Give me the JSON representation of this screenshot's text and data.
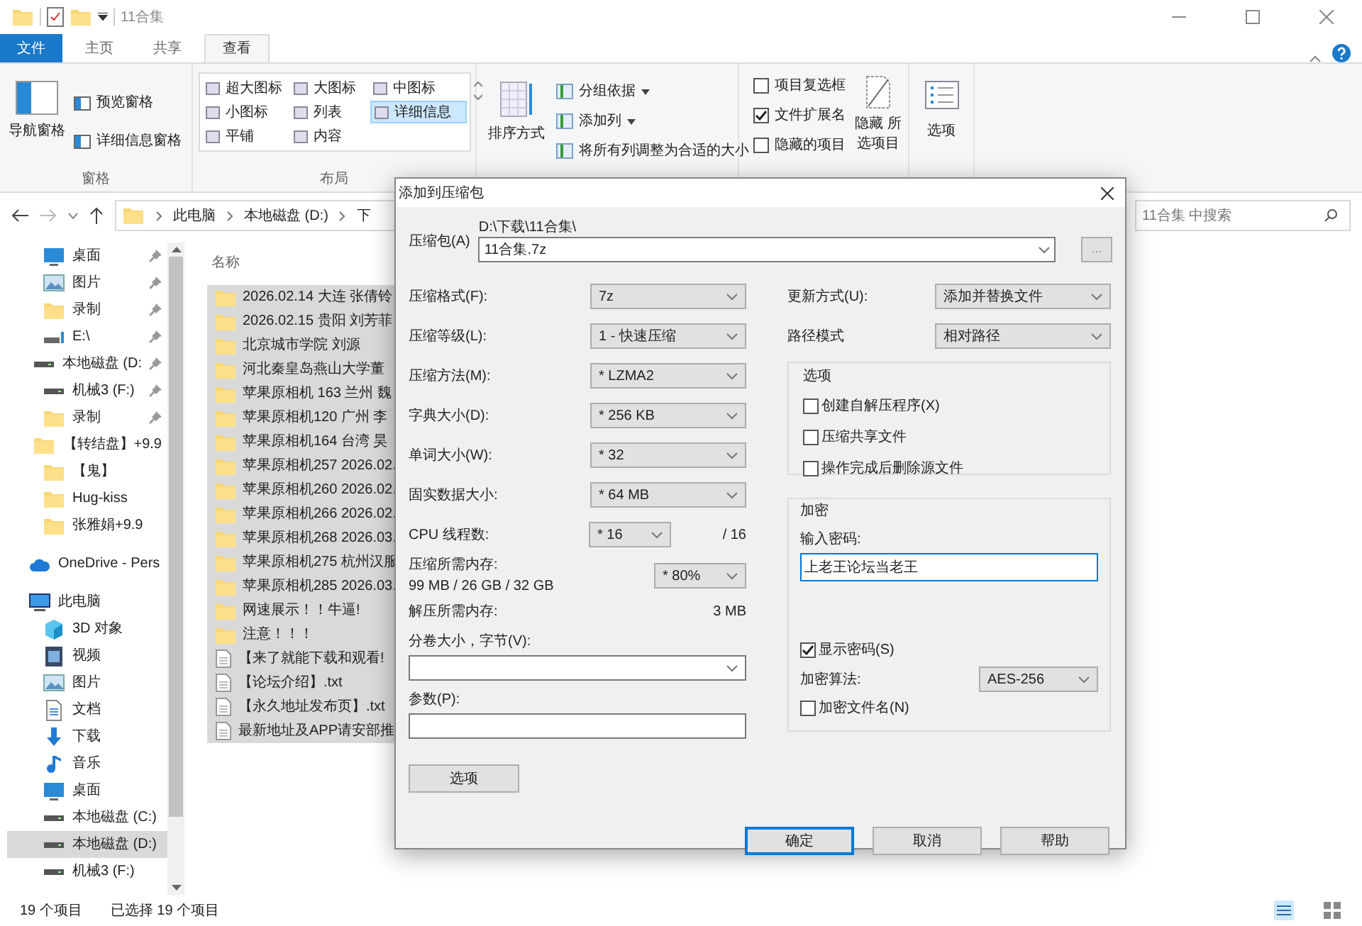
{
  "window": {
    "title": "11合集"
  },
  "ribbon_tabs": [
    {
      "label": "文件",
      "kind": "file",
      "selected": false
    },
    {
      "label": "主页",
      "kind": "tab",
      "selected": false
    },
    {
      "label": "共享",
      "kind": "tab",
      "selected": false
    },
    {
      "label": "查看",
      "kind": "tab",
      "selected": true
    }
  ],
  "ribbon": {
    "panes": {
      "nav_pane": "导航窗格",
      "buttons": [
        "预览窗格",
        "详细信息窗格"
      ],
      "group": "窗格"
    },
    "layout": {
      "options": [
        {
          "label": "超大图标",
          "selected": false
        },
        {
          "label": "大图标",
          "selected": false
        },
        {
          "label": "中图标",
          "selected": false
        },
        {
          "label": "小图标",
          "selected": false
        },
        {
          "label": "列表",
          "selected": false
        },
        {
          "label": "详细信息",
          "selected": true
        },
        {
          "label": "平铺",
          "selected": false
        },
        {
          "label": "内容",
          "selected": false
        }
      ],
      "group": "布局"
    },
    "current_view": {
      "sort": "排序方式",
      "buttons": [
        "分组依据",
        "添加列",
        "将所有列调整为合适的大小"
      ]
    },
    "show_hide": {
      "checkboxes": [
        {
          "label": "项目复选框",
          "checked": false
        },
        {
          "label": "文件扩展名",
          "checked": true
        },
        {
          "label": "隐藏的项目",
          "checked": false
        }
      ],
      "hide_selected": "隐藏 所选项目"
    },
    "options": "选项"
  },
  "address": {
    "crumbs": [
      "此电脑",
      "本地磁盘 (D:)",
      "下"
    ]
  },
  "search": {
    "placeholder": "11合集 中搜索"
  },
  "nav_pane": {
    "items": [
      {
        "label": "桌面",
        "kind": "desktop",
        "pinned": true,
        "selected": false
      },
      {
        "label": "图片",
        "kind": "pictures",
        "pinned": true,
        "selected": false
      },
      {
        "label": "录制",
        "kind": "folder",
        "pinned": true,
        "selected": false
      },
      {
        "label": "E:\\",
        "kind": "netdrive",
        "pinned": true,
        "selected": false
      },
      {
        "label": "本地磁盘 (D:",
        "kind": "drive",
        "pinned": true,
        "selected": false
      },
      {
        "label": "机械3 (F:)",
        "kind": "drive",
        "pinned": true,
        "selected": false
      },
      {
        "label": "录制",
        "kind": "folder",
        "pinned": true,
        "selected": false
      },
      {
        "label": "【转结盘】+9.9",
        "kind": "folder",
        "pinned": false,
        "selected": false
      },
      {
        "label": "【鬼】",
        "kind": "folder",
        "pinned": false,
        "selected": false
      },
      {
        "label": "Hug-kiss",
        "kind": "folder",
        "pinned": false,
        "selected": false
      },
      {
        "label": "张雅娟+9.9",
        "kind": "folder",
        "pinned": false,
        "selected": false
      },
      {
        "label": "OneDrive - Pers",
        "kind": "cloud",
        "pinned": false,
        "selected": false
      },
      {
        "label": "此电脑",
        "kind": "pc",
        "pinned": false,
        "selected": false
      },
      {
        "label": "3D 对象",
        "kind": "cube",
        "pinned": false,
        "selected": false
      },
      {
        "label": "视频",
        "kind": "video",
        "pinned": false,
        "selected": false
      },
      {
        "label": "图片",
        "kind": "pictures",
        "pinned": false,
        "selected": false
      },
      {
        "label": "文档",
        "kind": "document",
        "pinned": false,
        "selected": false
      },
      {
        "label": "下载",
        "kind": "download",
        "pinned": false,
        "selected": false
      },
      {
        "label": "音乐",
        "kind": "music",
        "pinned": false,
        "selected": false
      },
      {
        "label": "桌面",
        "kind": "desktop",
        "pinned": false,
        "selected": false
      },
      {
        "label": "本地磁盘 (C:)",
        "kind": "drive",
        "pinned": false,
        "selected": false
      },
      {
        "label": "本地磁盘 (D:)",
        "kind": "drive",
        "pinned": false,
        "selected": true
      },
      {
        "label": "机械3 (F:)",
        "kind": "drive",
        "pinned": false,
        "selected": false
      }
    ]
  },
  "file_list": {
    "column": "名称",
    "files": [
      {
        "name": "2026.02.14 大连 张倩铃",
        "kind": "folder",
        "selected": true
      },
      {
        "name": "2026.02.15 贵阳 刘芳菲",
        "kind": "folder",
        "selected": true
      },
      {
        "name": "北京城市学院 刘源",
        "kind": "folder",
        "selected": true
      },
      {
        "name": "河北秦皇岛燕山大学董",
        "kind": "folder",
        "selected": true
      },
      {
        "name": "苹果原相机 163 兰州 魏",
        "kind": "folder",
        "selected": true
      },
      {
        "name": "苹果原相机120 广州 李",
        "kind": "folder",
        "selected": true
      },
      {
        "name": "苹果原相机164 台湾 昊",
        "kind": "folder",
        "selected": true
      },
      {
        "name": "苹果原相机257 2026.02.",
        "kind": "folder",
        "selected": true
      },
      {
        "name": "苹果原相机260 2026.02.",
        "kind": "folder",
        "selected": true
      },
      {
        "name": "苹果原相机266 2026.02.",
        "kind": "folder",
        "selected": true
      },
      {
        "name": "苹果原相机268 2026.03.",
        "kind": "folder",
        "selected": true
      },
      {
        "name": "苹果原相机275 杭州汉服",
        "kind": "folder",
        "selected": true
      },
      {
        "name": "苹果原相机285 2026.03.",
        "kind": "folder",
        "selected": true
      },
      {
        "name": "网速展示！！牛逼!",
        "kind": "folder",
        "selected": true
      },
      {
        "name": "注意！！！",
        "kind": "folder",
        "selected": true
      },
      {
        "name": "【来了就能下载和观看!",
        "kind": "text",
        "selected": true
      },
      {
        "name": "【论坛介绍】.txt",
        "kind": "text",
        "selected": true
      },
      {
        "name": "【永久地址发布页】.txt",
        "kind": "text",
        "selected": true
      },
      {
        "name": "最新地址及APP请安部推",
        "kind": "text",
        "selected": true
      }
    ]
  },
  "status_bar": {
    "count": "19 个项目",
    "selection": "已选择 19 个项目"
  },
  "dialog": {
    "title": "添加到压缩包",
    "archive": {
      "label": "压缩包(A)",
      "path": "D:\\下载\\11合集\\",
      "name": "11合集.7z",
      "browse": "..."
    },
    "settings": [
      {
        "label": "压缩格式(F):",
        "value": "7z"
      },
      {
        "label": "压缩等级(L):",
        "value": "1 - 快速压缩"
      },
      {
        "label": "压缩方法(M):",
        "value": "* LZMA2"
      },
      {
        "label": "字典大小(D):",
        "value": "* 256 KB"
      },
      {
        "label": "单词大小(W):",
        "value": "* 32"
      },
      {
        "label": "固实数据大小:",
        "value": "* 64 MB"
      }
    ],
    "threads": {
      "label": "CPU 线程数:",
      "value": "* 16",
      "max": "/ 16"
    },
    "memory": {
      "label": "压缩所需内存:",
      "detail": "99 MB / 26 GB / 32 GB",
      "value": "* 80%"
    },
    "decompress_memory": {
      "label": "解压所需内存:",
      "value": "3 MB"
    },
    "volume": {
      "label": "分卷大小，字节(V):"
    },
    "parameters": {
      "label": "参数(P):"
    },
    "options_button": "选项",
    "update_mode": {
      "label": "更新方式(U):",
      "value": "添加并替换文件"
    },
    "path_mode": {
      "label": "路径模式",
      "value": "相对路径"
    },
    "options_group": {
      "title": "选项",
      "checkboxes": [
        {
          "label": "创建自解压程序(X)",
          "checked": false
        },
        {
          "label": "压缩共享文件",
          "checked": false
        },
        {
          "label": "操作完成后删除源文件",
          "checked": false
        }
      ]
    },
    "encryption": {
      "title": "加密",
      "password_label": "输入密码:",
      "password": "上老王论坛当老王",
      "show_password": {
        "label": "显示密码(S)",
        "checked": true
      },
      "method_label": "加密算法:",
      "method": "AES-256",
      "encrypt_names": {
        "label": "加密文件名(N)",
        "checked": false
      }
    },
    "buttons": [
      {
        "label": "确定",
        "focused": true
      },
      {
        "label": "取消",
        "focused": false
      },
      {
        "label": "帮助",
        "focused": false
      }
    ]
  }
}
